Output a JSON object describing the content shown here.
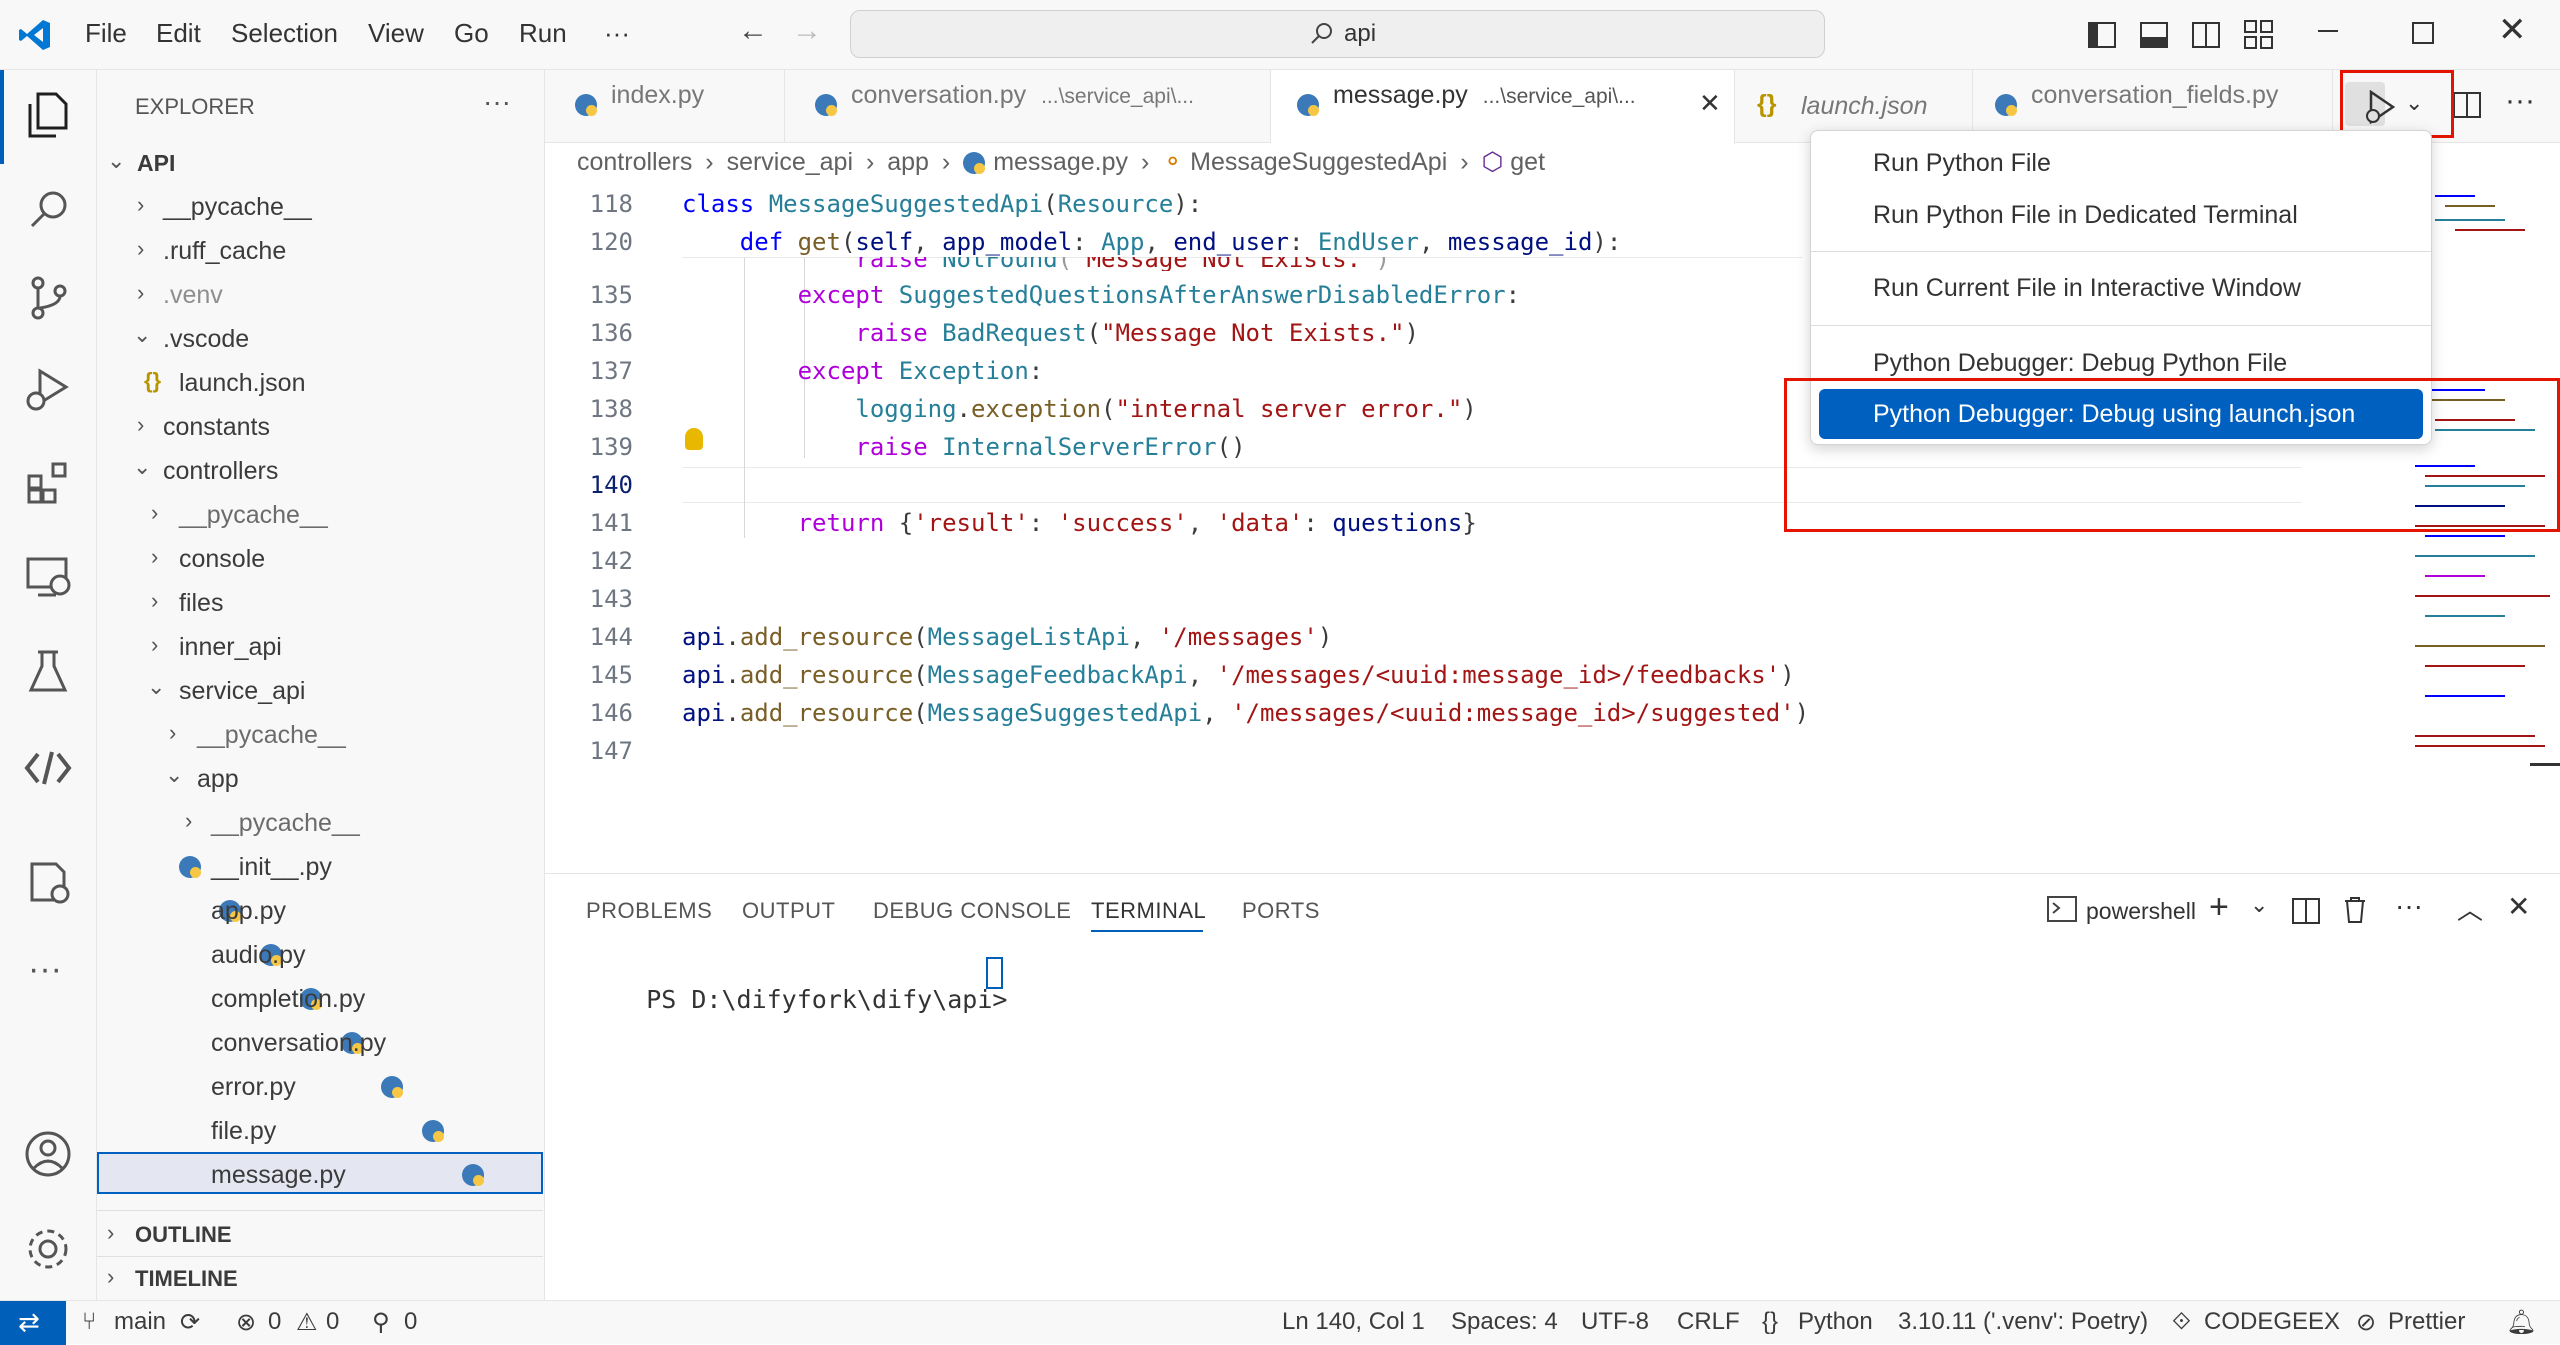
{
  "menu": {
    "file": "File",
    "edit": "Edit",
    "selection": "Selection",
    "view": "View",
    "go": "Go",
    "run": "Run",
    "more": "···"
  },
  "search": {
    "text": "api"
  },
  "explorer": {
    "title": "EXPLORER",
    "root": "API",
    "items": [
      "__pycache__",
      ".ruff_cache",
      ".venv",
      ".vscode",
      "launch.json",
      "constants",
      "controllers",
      "__pycache__",
      "console",
      "files",
      "inner_api",
      "service_api",
      "__pycache__",
      "app",
      "__pycache__",
      "__init__.py",
      "app.py",
      "audio.py",
      "completion.py",
      "conversation.py",
      "error.py",
      "file.py",
      "message.py"
    ],
    "outline": "OUTLINE",
    "timeline": "TIMELINE"
  },
  "tabs": [
    {
      "label": "index.py",
      "desc": ""
    },
    {
      "label": "conversation.py",
      "desc": "...\\service_api\\..."
    },
    {
      "label": "message.py",
      "desc": "...\\service_api\\..."
    },
    {
      "label": "launch.json",
      "desc": ""
    },
    {
      "label": "conversation_fields.py",
      "desc": ""
    }
  ],
  "breadcrumb": {
    "p1": "controllers",
    "p2": "service_api",
    "p3": "app",
    "p4": "message.py",
    "p5": "MessageSuggestedApi",
    "p6": "get"
  },
  "editor": {
    "lines": [
      "118",
      "120",
      "135",
      "136",
      "137",
      "138",
      "139",
      "140",
      "141",
      "142",
      "143",
      "144",
      "145",
      "146",
      "147"
    ]
  },
  "dropdown": {
    "items": [
      "Run Python File",
      "Run Python File in Dedicated Terminal",
      "Run Current File in Interactive Window",
      "Python Debugger: Debug Python File",
      "Python Debugger: Debug using launch.json"
    ]
  },
  "panel": {
    "tabs": [
      "PROBLEMS",
      "OUTPUT",
      "DEBUG CONSOLE",
      "TERMINAL",
      "PORTS"
    ],
    "shell": "powershell",
    "prompt": "PS D:\\difyfork\\dify\\api>"
  },
  "status": {
    "branch": "main",
    "errors": "0",
    "warnings": "0",
    "ports": "0",
    "position": "Ln 140, Col 1",
    "spaces": "Spaces: 4",
    "encoding": "UTF-8",
    "eol": "CRLF",
    "language": "Python",
    "interpreter": "3.10.11 ('.venv': Poetry)",
    "codegeex": "CODEGEEX",
    "prettier": "Prettier"
  },
  "colors": {
    "accent": "#005fb8",
    "highlight": "#0060c0",
    "red": "#e51400"
  }
}
